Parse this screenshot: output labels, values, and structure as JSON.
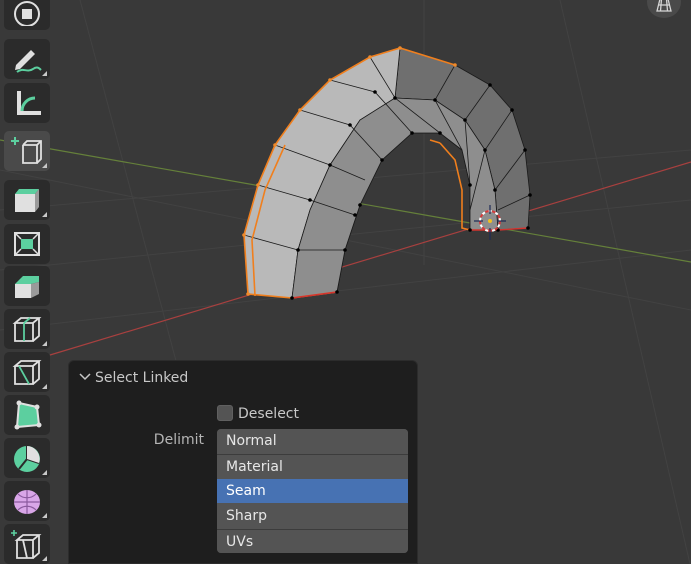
{
  "viewport": {
    "mesh": "torus-half-arch"
  },
  "toolbar": {
    "tools": [
      {
        "name": "transform",
        "icon": "transform-icon"
      },
      {
        "name": "annotate",
        "icon": "annotate-pencil-icon"
      },
      {
        "name": "measure",
        "icon": "measure-ruler-icon"
      },
      {
        "name": "add-cube",
        "icon": "add-cube-icon"
      },
      {
        "name": "extrude",
        "icon": "extrude-region-icon"
      },
      {
        "name": "inset",
        "icon": "inset-faces-icon"
      },
      {
        "name": "bevel",
        "icon": "bevel-icon"
      },
      {
        "name": "loop-cut",
        "icon": "loop-cut-icon"
      },
      {
        "name": "knife",
        "icon": "knife-icon"
      },
      {
        "name": "poly-build",
        "icon": "poly-build-icon"
      },
      {
        "name": "spin",
        "icon": "spin-icon"
      },
      {
        "name": "smooth",
        "icon": "smooth-vertices-icon"
      },
      {
        "name": "edge-slide",
        "icon": "edge-slide-icon"
      }
    ]
  },
  "panel": {
    "title": "Select Linked",
    "deselect": {
      "label": "Deselect",
      "checked": false
    },
    "delimit": {
      "label": "Delimit",
      "options": [
        "Normal",
        "Material",
        "Seam",
        "Sharp",
        "UVs"
      ],
      "selected": "Seam"
    }
  },
  "colors": {
    "selected_edge": "#f07f1d",
    "selection_highlight": "#4772b3",
    "x_axis": "#b04545",
    "y_axis": "#6f8a3a",
    "mesh_face": "#a9a9a9"
  }
}
